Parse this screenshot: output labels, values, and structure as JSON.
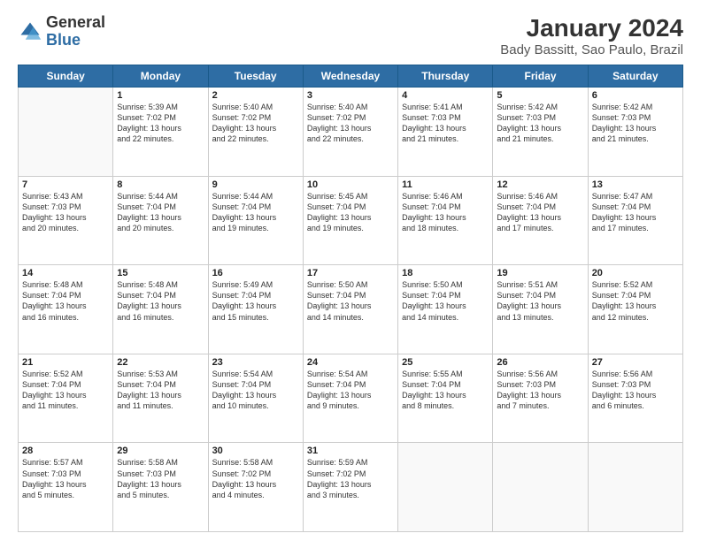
{
  "header": {
    "logo_general": "General",
    "logo_blue": "Blue",
    "title": "January 2024",
    "subtitle": "Bady Bassitt, Sao Paulo, Brazil"
  },
  "weekdays": [
    "Sunday",
    "Monday",
    "Tuesday",
    "Wednesday",
    "Thursday",
    "Friday",
    "Saturday"
  ],
  "weeks": [
    [
      {
        "day": "",
        "info": ""
      },
      {
        "day": "1",
        "info": "Sunrise: 5:39 AM\nSunset: 7:02 PM\nDaylight: 13 hours\nand 22 minutes."
      },
      {
        "day": "2",
        "info": "Sunrise: 5:40 AM\nSunset: 7:02 PM\nDaylight: 13 hours\nand 22 minutes."
      },
      {
        "day": "3",
        "info": "Sunrise: 5:40 AM\nSunset: 7:02 PM\nDaylight: 13 hours\nand 22 minutes."
      },
      {
        "day": "4",
        "info": "Sunrise: 5:41 AM\nSunset: 7:03 PM\nDaylight: 13 hours\nand 21 minutes."
      },
      {
        "day": "5",
        "info": "Sunrise: 5:42 AM\nSunset: 7:03 PM\nDaylight: 13 hours\nand 21 minutes."
      },
      {
        "day": "6",
        "info": "Sunrise: 5:42 AM\nSunset: 7:03 PM\nDaylight: 13 hours\nand 21 minutes."
      }
    ],
    [
      {
        "day": "7",
        "info": "Sunrise: 5:43 AM\nSunset: 7:03 PM\nDaylight: 13 hours\nand 20 minutes."
      },
      {
        "day": "8",
        "info": "Sunrise: 5:44 AM\nSunset: 7:04 PM\nDaylight: 13 hours\nand 20 minutes."
      },
      {
        "day": "9",
        "info": "Sunrise: 5:44 AM\nSunset: 7:04 PM\nDaylight: 13 hours\nand 19 minutes."
      },
      {
        "day": "10",
        "info": "Sunrise: 5:45 AM\nSunset: 7:04 PM\nDaylight: 13 hours\nand 19 minutes."
      },
      {
        "day": "11",
        "info": "Sunrise: 5:46 AM\nSunset: 7:04 PM\nDaylight: 13 hours\nand 18 minutes."
      },
      {
        "day": "12",
        "info": "Sunrise: 5:46 AM\nSunset: 7:04 PM\nDaylight: 13 hours\nand 17 minutes."
      },
      {
        "day": "13",
        "info": "Sunrise: 5:47 AM\nSunset: 7:04 PM\nDaylight: 13 hours\nand 17 minutes."
      }
    ],
    [
      {
        "day": "14",
        "info": "Sunrise: 5:48 AM\nSunset: 7:04 PM\nDaylight: 13 hours\nand 16 minutes."
      },
      {
        "day": "15",
        "info": "Sunrise: 5:48 AM\nSunset: 7:04 PM\nDaylight: 13 hours\nand 16 minutes."
      },
      {
        "day": "16",
        "info": "Sunrise: 5:49 AM\nSunset: 7:04 PM\nDaylight: 13 hours\nand 15 minutes."
      },
      {
        "day": "17",
        "info": "Sunrise: 5:50 AM\nSunset: 7:04 PM\nDaylight: 13 hours\nand 14 minutes."
      },
      {
        "day": "18",
        "info": "Sunrise: 5:50 AM\nSunset: 7:04 PM\nDaylight: 13 hours\nand 14 minutes."
      },
      {
        "day": "19",
        "info": "Sunrise: 5:51 AM\nSunset: 7:04 PM\nDaylight: 13 hours\nand 13 minutes."
      },
      {
        "day": "20",
        "info": "Sunrise: 5:52 AM\nSunset: 7:04 PM\nDaylight: 13 hours\nand 12 minutes."
      }
    ],
    [
      {
        "day": "21",
        "info": "Sunrise: 5:52 AM\nSunset: 7:04 PM\nDaylight: 13 hours\nand 11 minutes."
      },
      {
        "day": "22",
        "info": "Sunrise: 5:53 AM\nSunset: 7:04 PM\nDaylight: 13 hours\nand 11 minutes."
      },
      {
        "day": "23",
        "info": "Sunrise: 5:54 AM\nSunset: 7:04 PM\nDaylight: 13 hours\nand 10 minutes."
      },
      {
        "day": "24",
        "info": "Sunrise: 5:54 AM\nSunset: 7:04 PM\nDaylight: 13 hours\nand 9 minutes."
      },
      {
        "day": "25",
        "info": "Sunrise: 5:55 AM\nSunset: 7:04 PM\nDaylight: 13 hours\nand 8 minutes."
      },
      {
        "day": "26",
        "info": "Sunrise: 5:56 AM\nSunset: 7:03 PM\nDaylight: 13 hours\nand 7 minutes."
      },
      {
        "day": "27",
        "info": "Sunrise: 5:56 AM\nSunset: 7:03 PM\nDaylight: 13 hours\nand 6 minutes."
      }
    ],
    [
      {
        "day": "28",
        "info": "Sunrise: 5:57 AM\nSunset: 7:03 PM\nDaylight: 13 hours\nand 5 minutes."
      },
      {
        "day": "29",
        "info": "Sunrise: 5:58 AM\nSunset: 7:03 PM\nDaylight: 13 hours\nand 5 minutes."
      },
      {
        "day": "30",
        "info": "Sunrise: 5:58 AM\nSunset: 7:02 PM\nDaylight: 13 hours\nand 4 minutes."
      },
      {
        "day": "31",
        "info": "Sunrise: 5:59 AM\nSunset: 7:02 PM\nDaylight: 13 hours\nand 3 minutes."
      },
      {
        "day": "",
        "info": ""
      },
      {
        "day": "",
        "info": ""
      },
      {
        "day": "",
        "info": ""
      }
    ]
  ]
}
